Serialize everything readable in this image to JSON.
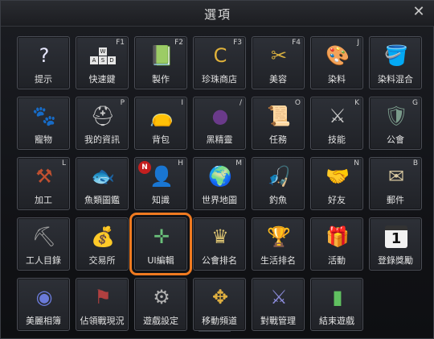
{
  "window": {
    "title": "選項",
    "close_glyph": "✕"
  },
  "tiles": [
    {
      "label": "提示",
      "key": "",
      "icon": "question-icon",
      "glyph": "?",
      "color": "#e8e8ff"
    },
    {
      "label": "快速鍵",
      "key": "F1",
      "icon": "keyboard-keys-icon",
      "glyph": "",
      "color": "#e7e7e7"
    },
    {
      "label": "製作",
      "key": "F2",
      "icon": "crafting-book-icon",
      "glyph": "📗",
      "color": "#5ab05a"
    },
    {
      "label": "珍珠商店",
      "key": "F3",
      "icon": "pearl-coin-icon",
      "glyph": "C",
      "color": "#e0b23a"
    },
    {
      "label": "美容",
      "key": "F4",
      "icon": "comb-icon",
      "glyph": "✂",
      "color": "#d8b040"
    },
    {
      "label": "染料",
      "key": "J",
      "icon": "palette-icon",
      "glyph": "🎨",
      "color": "#d8a060"
    },
    {
      "label": "染料混合",
      "key": "",
      "icon": "dye-bucket-icon",
      "glyph": "🪣",
      "color": "#4aa0d8"
    },
    {
      "label": "寵物",
      "key": "",
      "icon": "paw-icon",
      "glyph": "🐾",
      "color": "#f0c8c8"
    },
    {
      "label": "我的資訊",
      "key": "P",
      "icon": "helmet-icon",
      "glyph": "⛑",
      "color": "#c8c8c8"
    },
    {
      "label": "背包",
      "key": "I",
      "icon": "bag-icon",
      "glyph": "👝",
      "color": "#a0602a"
    },
    {
      "label": "黑精靈",
      "key": "/",
      "icon": "black-spirit-icon",
      "glyph": "●",
      "color": "#6a3a8a"
    },
    {
      "label": "任務",
      "key": "O",
      "icon": "scroll-icon",
      "glyph": "📜",
      "color": "#d8c090"
    },
    {
      "label": "技能",
      "key": "K",
      "icon": "axe-icon",
      "glyph": "⚔",
      "color": "#c8c8c8"
    },
    {
      "label": "公會",
      "key": "G",
      "icon": "guild-shield-icon",
      "glyph": "🛡",
      "color": "#7a9a8a"
    },
    {
      "label": "加工",
      "key": "L",
      "icon": "processing-tools-icon",
      "glyph": "⚒",
      "color": "#c05030"
    },
    {
      "label": "魚類圖鑑",
      "key": "",
      "icon": "fish-icon",
      "glyph": "🐟",
      "color": "#50b0c0"
    },
    {
      "label": "知識",
      "key": "H",
      "icon": "knowledge-head-icon",
      "glyph": "👤",
      "color": "#e0c040",
      "badge": "N"
    },
    {
      "label": "世界地圖",
      "key": "M",
      "icon": "globe-icon",
      "glyph": "🌍",
      "color": "#60a060"
    },
    {
      "label": "釣魚",
      "key": "",
      "icon": "fishing-icon",
      "glyph": "🎣",
      "color": "#4a80d8"
    },
    {
      "label": "好友",
      "key": "N",
      "icon": "handshake-icon",
      "glyph": "🤝",
      "color": "#d8b080"
    },
    {
      "label": "郵件",
      "key": "B",
      "icon": "mail-icon",
      "glyph": "✉",
      "color": "#d8c8a0"
    },
    {
      "label": "工人目錄",
      "key": "",
      "icon": "pickaxe-icon",
      "glyph": "⛏",
      "color": "#a0a0a0"
    },
    {
      "label": "交易所",
      "key": "",
      "icon": "trade-goods-icon",
      "glyph": "💰",
      "color": "#e0b030"
    },
    {
      "label": "UI編輯",
      "key": "",
      "icon": "move-arrows-icon",
      "glyph": "✛",
      "color": "#6ac07a",
      "selected": true
    },
    {
      "label": "公會排名",
      "key": "",
      "icon": "guild-ranking-icon",
      "glyph": "♛",
      "color": "#d8c070"
    },
    {
      "label": "生活排名",
      "key": "",
      "icon": "trophy-icon",
      "glyph": "🏆",
      "color": "#e0a030"
    },
    {
      "label": "活動",
      "key": "",
      "icon": "gift-box-icon",
      "glyph": "🎁",
      "color": "#d84040"
    },
    {
      "label": "登錄獎勵",
      "key": "",
      "icon": "calendar-icon",
      "glyph": "1",
      "color": "#111111"
    },
    {
      "label": "美麗相簿",
      "key": "",
      "icon": "photo-album-icon",
      "glyph": "◉",
      "color": "#6a7ad8"
    },
    {
      "label": "佔領戰現況",
      "key": "",
      "icon": "siege-banner-icon",
      "glyph": "⚑",
      "color": "#b04040"
    },
    {
      "label": "遊戲設定",
      "key": "",
      "icon": "gear-icon",
      "glyph": "⚙",
      "color": "#b0b0b0"
    },
    {
      "label": "移動頻道",
      "key": "",
      "icon": "channel-move-icon",
      "glyph": "✥",
      "color": "#e0b040"
    },
    {
      "label": "對戰管理",
      "key": "",
      "icon": "battle-crest-icon",
      "glyph": "⚔",
      "color": "#8a8ad8"
    },
    {
      "label": "結束遊戲",
      "key": "",
      "icon": "exit-lantern-icon",
      "glyph": "▮",
      "color": "#60c060"
    }
  ]
}
